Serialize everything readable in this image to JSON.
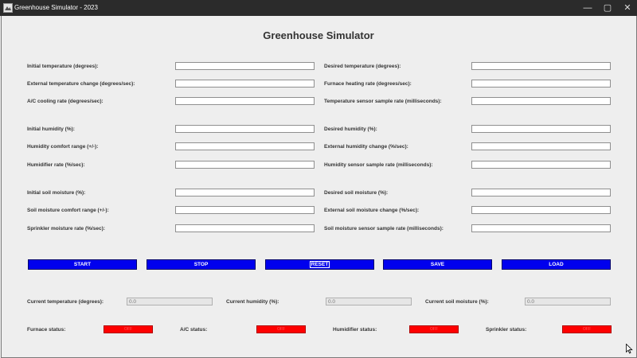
{
  "window": {
    "title": "Greenhouse Simulator - 2023",
    "controls": {
      "minimize": "—",
      "maximize": "▢",
      "close": "✕"
    }
  },
  "heading": "Greenhouse Simulator",
  "temperature": {
    "initial_label": "Initial temperature (degrees):",
    "initial_value": "",
    "external_change_label": "External temperature change (degrees/sec):",
    "external_change_value": "",
    "ac_rate_label": "A/C cooling rate (degrees/sec):",
    "ac_rate_value": "",
    "desired_label": "Desired temperature (degrees):",
    "desired_value": "",
    "furnace_rate_label": "Furnace heating rate (degrees/sec):",
    "furnace_rate_value": "",
    "sample_rate_label": "Temperature sensor sample rate (milliseconds):",
    "sample_rate_value": ""
  },
  "humidity": {
    "initial_label": "Initial humidity (%):",
    "initial_value": "",
    "comfort_label": "Humidity comfort range (+/-):",
    "comfort_value": "",
    "humidifier_label": "Humidifier rate (%/sec):",
    "humidifier_value": "",
    "desired_label": "Desired humidity (%):",
    "desired_value": "",
    "external_change_label": "External humidity change (%/sec):",
    "external_change_value": "",
    "sample_rate_label": "Humidity sensor sample rate (milliseconds):",
    "sample_rate_value": ""
  },
  "soil": {
    "initial_label": "Initial soil moisture (%):",
    "initial_value": "",
    "comfort_label": "Soil moisture comfort range (+/-):",
    "comfort_value": "",
    "sprinkler_label": "Sprinkler moisture rate (%/sec):",
    "sprinkler_value": "",
    "desired_label": "Desired soil moisture (%):",
    "desired_value": "",
    "external_change_label": "External soil moisture change (%/sec):",
    "external_change_value": "",
    "sample_rate_label": "Soil moisture sensor sample rate (milliseconds):",
    "sample_rate_value": ""
  },
  "buttons": {
    "start": "START",
    "stop": "STOP",
    "reset": "RESET",
    "save": "SAVE",
    "load": "LOAD",
    "color": "#0000ee"
  },
  "readouts": {
    "current_temperature_label": "Current temperature (degrees):",
    "current_temperature_value": "0.0",
    "current_humidity_label": "Current humidity (%):",
    "current_humidity_value": "0.0",
    "current_soil_label": "Current soil moisture (%):",
    "current_soil_value": "0.0"
  },
  "statuses": {
    "furnace_label": "Furnace status:",
    "furnace_value": "OFF",
    "ac_label": "A/C status:",
    "ac_value": "OFF",
    "humidifier_label": "Humidifier status:",
    "humidifier_value": "OFF",
    "sprinkler_label": "Sprinkler status:",
    "sprinkler_value": "OFF",
    "off_color": "#ff0000"
  }
}
